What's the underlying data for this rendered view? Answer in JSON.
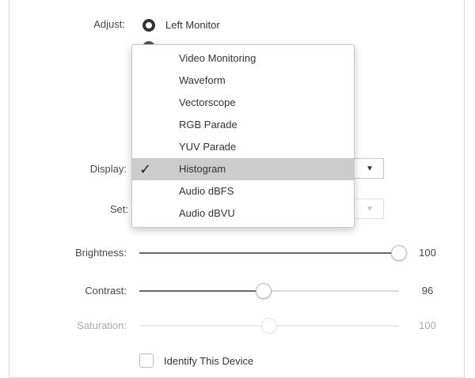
{
  "adjust": {
    "label": "Adjust:",
    "options": [
      "Left Monitor"
    ]
  },
  "display": {
    "label": "Display:"
  },
  "set": {
    "label": "Set:"
  },
  "dropdown": {
    "items": [
      "Video Monitoring",
      "Waveform",
      "Vectorscope",
      "RGB Parade",
      "YUV Parade",
      "Histogram",
      "Audio dBFS",
      "Audio dBVU"
    ],
    "selected": "Histogram"
  },
  "sliders": {
    "brightness": {
      "label": "Brightness:",
      "value": "100",
      "fraction": 1.0
    },
    "contrast": {
      "label": "Contrast:",
      "value": "96",
      "fraction": 0.48
    },
    "saturation": {
      "label": "Saturation:",
      "value": "100",
      "fraction": 0.5,
      "disabled": true
    }
  },
  "identify": {
    "label": "Identify This Device",
    "checked": false
  },
  "icons": {
    "dropdown_arrow": "chevron-down-icon",
    "selected_check": "check-icon"
  },
  "colors": {
    "selected_bg": "#cccccc",
    "text": "#333333"
  }
}
